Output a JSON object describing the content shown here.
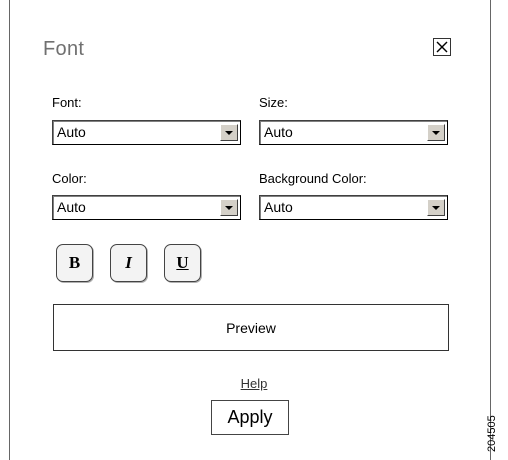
{
  "dialog": {
    "title": "Font",
    "close_icon": "close-x-icon"
  },
  "fields": {
    "font": {
      "label": "Font:",
      "value": "Auto"
    },
    "size": {
      "label": "Size:",
      "value": "Auto"
    },
    "color": {
      "label": "Color:",
      "value": "Auto"
    },
    "background_color": {
      "label": "Background Color:",
      "value": "Auto"
    }
  },
  "format_buttons": {
    "bold": "B",
    "italic": "I",
    "underline": "U"
  },
  "preview": {
    "label": "Preview"
  },
  "help": {
    "label": "Help"
  },
  "apply": {
    "label": "Apply"
  },
  "figure_id": "204505"
}
